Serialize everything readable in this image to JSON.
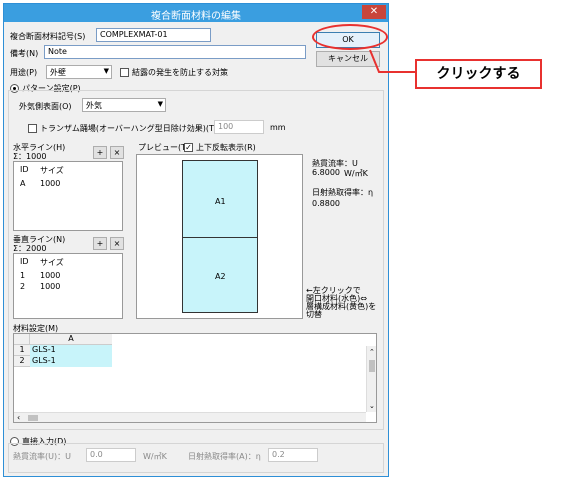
{
  "window": {
    "title": "複合断面材料の編集",
    "close": "✕"
  },
  "top": {
    "code_label": "複合断面材料記号(S)",
    "code_value": "COMPLEXMAT-01",
    "note_label": "備考(N)",
    "note_value": "Note",
    "use_label": "用途(P)",
    "use_value": "外壁",
    "condensation_label": "結露の発生を防止する対策",
    "ok": "OK",
    "cancel": "キャンセル"
  },
  "pattern": {
    "radio_label": "パターン設定(P)",
    "outer_label": "外気側表面(O)",
    "outer_value": "外気",
    "transom_label": "トランザム踊場(オーバーハング型日除け効果)(T)",
    "transom_value": "100",
    "transom_unit": "mm",
    "horizontal_title": "水平ライン(H)",
    "horizontal_sum": "Σ：1000",
    "vertical_title": "垂直ライン(N)",
    "vertical_sum": "Σ：2000",
    "plus": "+",
    "minus": "×",
    "col_id": "ID",
    "col_size": "サイズ",
    "h_rows": [
      {
        "id": "A",
        "size": "1000"
      }
    ],
    "v_rows": [
      {
        "id": "1",
        "size": "1000"
      },
      {
        "id": "2",
        "size": "1000"
      }
    ],
    "preview_label": "プレビュー(T)",
    "flip_label": "上下反転表示(R)",
    "flip_checked": "✓",
    "cell_a1": "A1",
    "cell_a2": "A2",
    "heat_label": "熱貫流率：U",
    "heat_value": "6.8000",
    "heat_unit": "W/㎡K",
    "solar_label": "日射熱取得率：η",
    "solar_value": "0.8800",
    "hint_line1": "←左クリックで",
    "hint_line2": "開口材料(水色)⇔",
    "hint_line3": "層構成材料(黄色)を",
    "hint_line4": "切替"
  },
  "material": {
    "title": "材料設定(M)",
    "col": "A",
    "rows": [
      {
        "num": "1",
        "value": "GLS-1"
      },
      {
        "num": "2",
        "value": "GLS-1"
      }
    ]
  },
  "direct": {
    "radio_label": "直接入力(D)",
    "heat_label": "熱貫流率(U)：U",
    "heat_value": "0.0",
    "heat_unit": "W/㎡K",
    "solar_label": "日射熱取得率(A)：η",
    "solar_value": "0.2"
  },
  "annotation": {
    "text": "クリックする",
    "color": "#e8312f"
  }
}
